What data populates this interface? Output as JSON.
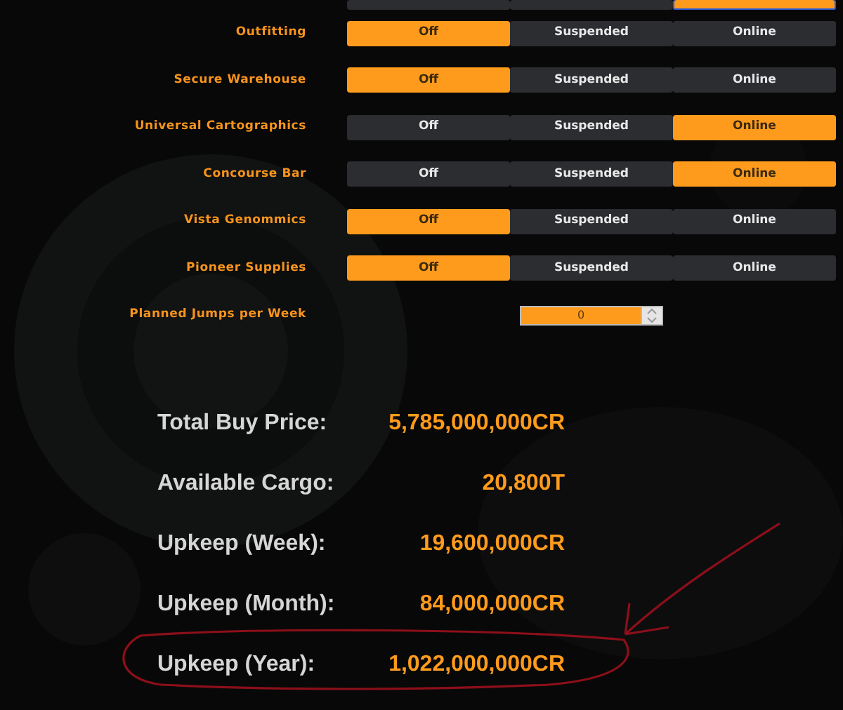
{
  "partial_service": {
    "options": [
      {
        "selected": false
      },
      {
        "selected": false
      },
      {
        "selected": true
      }
    ]
  },
  "services": [
    {
      "label": "Outfitting",
      "options": [
        {
          "label": "Off",
          "selected": true
        },
        {
          "label": "Suspended",
          "selected": false
        },
        {
          "label": "Online",
          "selected": false
        }
      ]
    },
    {
      "label": "Secure Warehouse",
      "options": [
        {
          "label": "Off",
          "selected": true
        },
        {
          "label": "Suspended",
          "selected": false
        },
        {
          "label": "Online",
          "selected": false
        }
      ]
    },
    {
      "label": "Universal Cartographics",
      "options": [
        {
          "label": "Off",
          "selected": false
        },
        {
          "label": "Suspended",
          "selected": false
        },
        {
          "label": "Online",
          "selected": true
        }
      ]
    },
    {
      "label": "Concourse Bar",
      "options": [
        {
          "label": "Off",
          "selected": false
        },
        {
          "label": "Suspended",
          "selected": false
        },
        {
          "label": "Online",
          "selected": true
        }
      ]
    },
    {
      "label": "Vista Genommics",
      "options": [
        {
          "label": "Off",
          "selected": true
        },
        {
          "label": "Suspended",
          "selected": false
        },
        {
          "label": "Online",
          "selected": false
        }
      ]
    },
    {
      "label": "Pioneer Supplies",
      "options": [
        {
          "label": "Off",
          "selected": true
        },
        {
          "label": "Suspended",
          "selected": false
        },
        {
          "label": "Online",
          "selected": false
        }
      ]
    }
  ],
  "jumps": {
    "label": "Planned Jumps per Week",
    "value": "0"
  },
  "totals": [
    {
      "label": "Total Buy Price:",
      "value": "5,785,000,000CR"
    },
    {
      "label": "Available Cargo:",
      "value": "20,800T"
    },
    {
      "label": "Upkeep (Week):",
      "value": "19,600,000CR"
    },
    {
      "label": "Upkeep (Month):",
      "value": "84,000,000CR"
    },
    {
      "label": "Upkeep (Year):",
      "value": "1,022,000,000CR"
    }
  ]
}
